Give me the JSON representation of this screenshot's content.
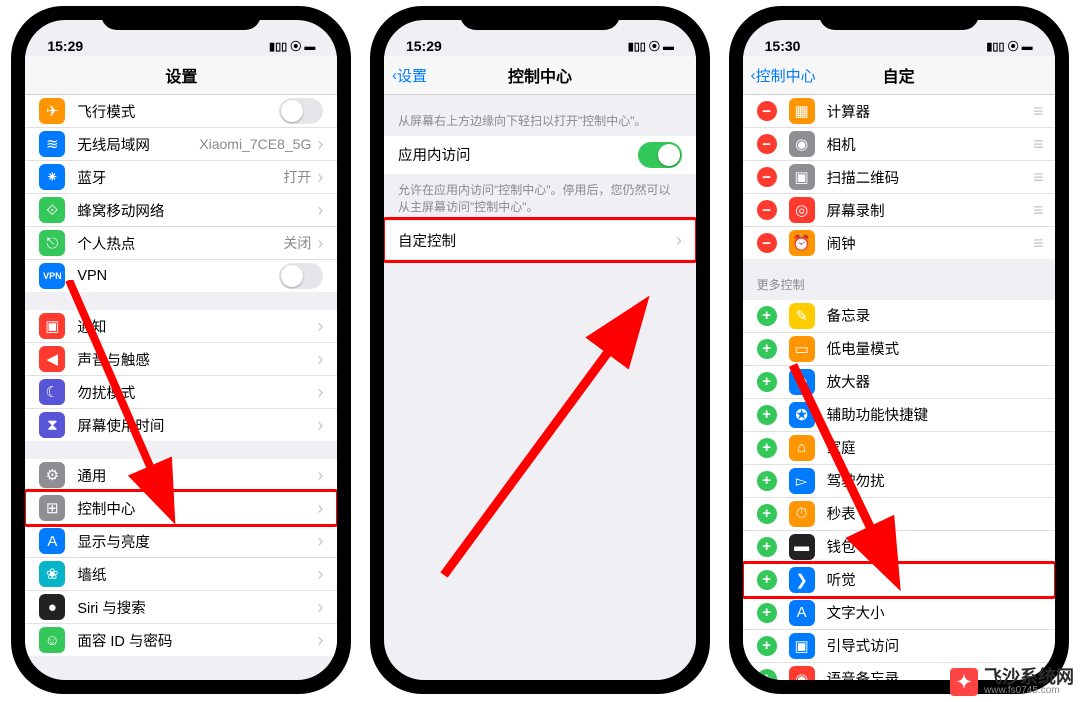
{
  "watermark": "飞沙系统网",
  "watermark_url": "www.fs0745.com",
  "phone1": {
    "time": "15:29",
    "title": "设置",
    "rows_g1": [
      {
        "icon": "✈",
        "bg": "#ff9500",
        "label": "飞行模式",
        "type": "toggle",
        "on": false
      },
      {
        "icon": "≋",
        "bg": "#007aff",
        "label": "无线局域网",
        "value": "Xiaomi_7CE8_5G",
        "type": "link"
      },
      {
        "icon": "⁕",
        "bg": "#007aff",
        "label": "蓝牙",
        "value": "打开",
        "type": "link"
      },
      {
        "icon": "⟐",
        "bg": "#34c759",
        "label": "蜂窝移动网络",
        "type": "link"
      },
      {
        "icon": "⎋",
        "bg": "#34c759",
        "label": "个人热点",
        "value": "关闭",
        "type": "link"
      },
      {
        "icon": "VPN",
        "bg": "#007aff",
        "label": "VPN",
        "type": "toggle",
        "on": false,
        "small": true
      }
    ],
    "rows_g2": [
      {
        "icon": "▣",
        "bg": "#ff3b30",
        "label": "通知",
        "type": "link"
      },
      {
        "icon": "◀",
        "bg": "#ff3b30",
        "label": "声音与触感",
        "type": "link"
      },
      {
        "icon": "☾",
        "bg": "#5856d6",
        "label": "勿扰模式",
        "type": "link"
      },
      {
        "icon": "⧗",
        "bg": "#5856d6",
        "label": "屏幕使用时间",
        "type": "link"
      }
    ],
    "rows_g3": [
      {
        "icon": "⚙",
        "bg": "#8e8e93",
        "label": "通用",
        "type": "link"
      },
      {
        "icon": "⊞",
        "bg": "#8e8e93",
        "label": "控制中心",
        "type": "link",
        "highlight": true
      },
      {
        "icon": "A",
        "bg": "#007aff",
        "label": "显示与亮度",
        "type": "link"
      },
      {
        "icon": "❀",
        "bg": "#06b5c9",
        "label": "墙纸",
        "type": "link"
      },
      {
        "icon": "●",
        "bg": "#222",
        "label": "Siri 与搜索",
        "type": "link"
      },
      {
        "icon": "☺",
        "bg": "#34c759",
        "label": "面容 ID 与密码",
        "type": "link"
      }
    ]
  },
  "phone2": {
    "time": "15:29",
    "back": "设置",
    "title": "控制中心",
    "header1": "从屏幕右上方边缘向下轻扫以打开\"控制中心\"。",
    "row_access": {
      "label": "应用内访问",
      "on": true
    },
    "footer_access": "允许在应用内访问\"控制中心\"。停用后，您仍然可以从主屏幕访问\"控制中心\"。",
    "row_custom": {
      "label": "自定控制"
    }
  },
  "phone3": {
    "time": "15:30",
    "back": "控制中心",
    "title": "自定",
    "included": [
      {
        "icon": "▦",
        "bg": "#ff9500",
        "label": "计算器"
      },
      {
        "icon": "◉",
        "bg": "#8e8e93",
        "label": "相机"
      },
      {
        "icon": "▣",
        "bg": "#8e8e93",
        "label": "扫描二维码"
      },
      {
        "icon": "◎",
        "bg": "#ff3b30",
        "label": "屏幕录制"
      },
      {
        "icon": "⏰",
        "bg": "#ff9500",
        "label": "闹钟"
      }
    ],
    "more_header": "更多控制",
    "more": [
      {
        "icon": "✎",
        "bg": "#ffcc00",
        "label": "备忘录"
      },
      {
        "icon": "▭",
        "bg": "#ff9500",
        "label": "低电量模式"
      },
      {
        "icon": "⊕",
        "bg": "#007aff",
        "label": "放大器"
      },
      {
        "icon": "✪",
        "bg": "#007aff",
        "label": "辅助功能快捷键"
      },
      {
        "icon": "⌂",
        "bg": "#ff9500",
        "label": "家庭"
      },
      {
        "icon": "▻",
        "bg": "#007aff",
        "label": "驾驶勿扰"
      },
      {
        "icon": "⏱",
        "bg": "#ff9500",
        "label": "秒表"
      },
      {
        "icon": "▬",
        "bg": "#222",
        "label": "钱包"
      },
      {
        "icon": "❯",
        "bg": "#007aff",
        "label": "听觉",
        "highlight": true
      },
      {
        "icon": "A",
        "bg": "#007aff",
        "label": "文字大小"
      },
      {
        "icon": "▣",
        "bg": "#007aff",
        "label": "引导式访问"
      },
      {
        "icon": "◉",
        "bg": "#ff3b30",
        "label": "语音备忘录"
      }
    ]
  }
}
